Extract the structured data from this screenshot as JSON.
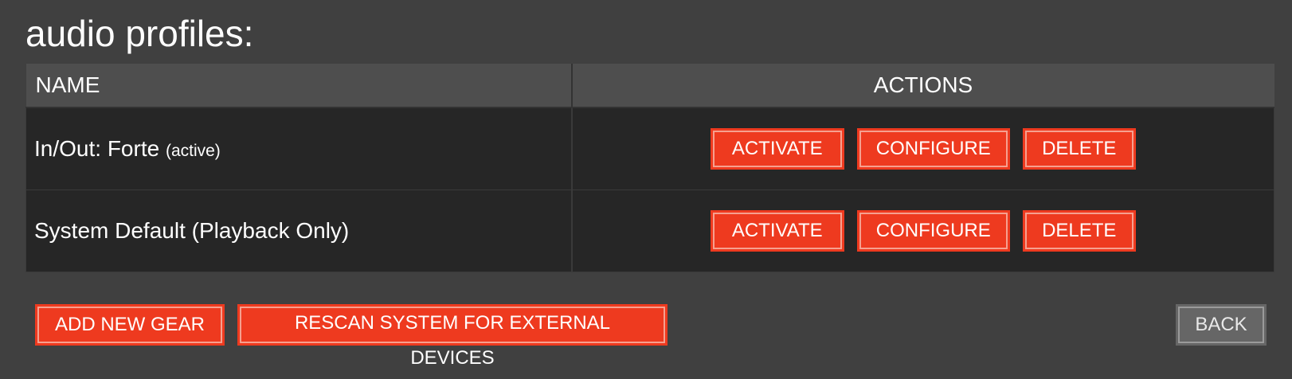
{
  "page": {
    "title": "audio profiles:"
  },
  "table": {
    "headers": {
      "name": "NAME",
      "actions": "ACTIONS"
    },
    "rows": [
      {
        "name": "In/Out: Forte",
        "tag": "(active)",
        "actions": {
          "activate": "ACTIVATE",
          "configure": "CONFIGURE",
          "delete": "DELETE"
        }
      },
      {
        "name": "System Default (Playback Only)",
        "tag": "",
        "actions": {
          "activate": "ACTIVATE",
          "configure": "CONFIGURE",
          "delete": "DELETE"
        }
      }
    ]
  },
  "footer": {
    "add_new_gear": "ADD NEW GEAR",
    "rescan": "RESCAN SYSTEM FOR EXTERNAL DEVICES",
    "back": "BACK"
  },
  "colors": {
    "background": "#404040",
    "header_background": "#4e4e4e",
    "row_background": "#262626",
    "accent_button": "#ee3a1f",
    "secondary_button": "#666666"
  }
}
